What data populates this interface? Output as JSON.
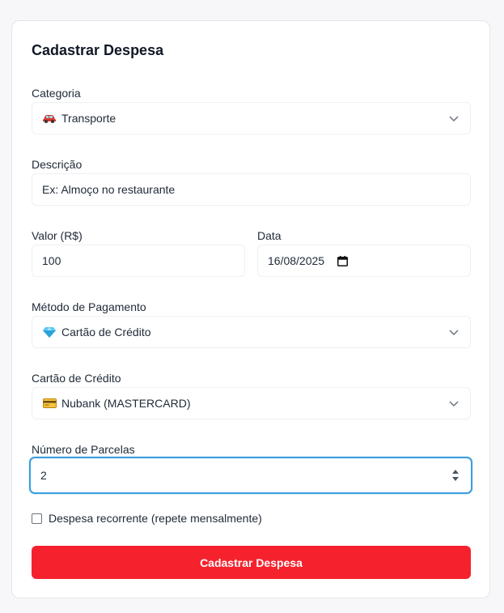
{
  "form": {
    "title": "Cadastrar Despesa",
    "category": {
      "label": "Categoria",
      "value": "Transporte",
      "icon": "car-emoji"
    },
    "description": {
      "label": "Descrição",
      "placeholder": "Ex: Almoço no restaurante"
    },
    "amount": {
      "label": "Valor (R$)",
      "value": "100"
    },
    "date": {
      "label": "Data",
      "value": "16/08/2025"
    },
    "payment_method": {
      "label": "Método de Pagamento",
      "value": "Cartão de Crédito",
      "icon": "gem-emoji"
    },
    "credit_card": {
      "label": "Cartão de Crédito",
      "value": "Nubank (MASTERCARD)",
      "icon": "credit-card-emoji"
    },
    "installments": {
      "label": "Número de Parcelas",
      "value": "2"
    },
    "recurring": {
      "label": "Despesa recorrente (repete mensalmente)",
      "checked": false
    },
    "submit_label": "Cadastrar Despesa"
  },
  "colors": {
    "accent": "#f5222d",
    "focus": "#3b9ede",
    "background": "#f7f7f9"
  }
}
